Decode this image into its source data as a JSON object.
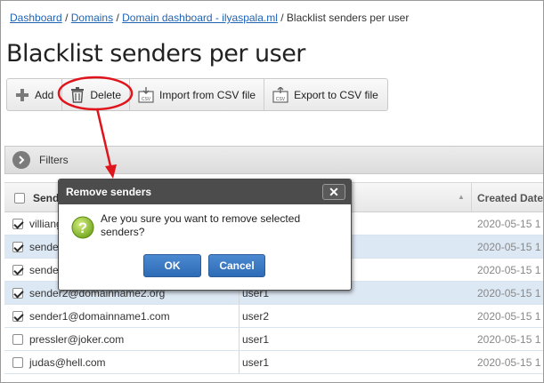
{
  "breadcrumb": {
    "items": [
      "Dashboard",
      "Domains",
      "Domain dashboard - ilyaspala.ml"
    ],
    "current": "Blacklist senders per user",
    "separator": "/"
  },
  "page_title": "Blacklist senders per user",
  "toolbar": {
    "add_label": "Add",
    "delete_label": "Delete",
    "import_label": "Import from CSV file",
    "export_label": "Export to CSV file",
    "csv_icon_text": "CSV"
  },
  "filters": {
    "label": "Filters"
  },
  "table": {
    "headers": {
      "sender": "Sender",
      "created": "Created Date"
    },
    "rows": [
      {
        "sender": "villiang",
        "user": "",
        "date": "2020-05-15 1",
        "checked": true,
        "selected": false
      },
      {
        "sender": "sender",
        "user": "",
        "date": "2020-05-15 1",
        "checked": true,
        "selected": true
      },
      {
        "sender": "sender",
        "user": "",
        "date": "2020-05-15 1",
        "checked": true,
        "selected": false
      },
      {
        "sender": "sender2@domainname2.org",
        "user": "user1",
        "date": "2020-05-15 1",
        "checked": true,
        "selected": true
      },
      {
        "sender": "sender1@domainname1.com",
        "user": "user2",
        "date": "2020-05-15 1",
        "checked": true,
        "selected": false
      },
      {
        "sender": "pressler@joker.com",
        "user": "user1",
        "date": "2020-05-15 1",
        "checked": false,
        "selected": false
      },
      {
        "sender": "judas@hell.com",
        "user": "user1",
        "date": "2020-05-15 1",
        "checked": false,
        "selected": false
      }
    ]
  },
  "dialog": {
    "title": "Remove senders",
    "close_symbol": "✕",
    "message": "Are you sure you want to remove selected senders?",
    "ok_label": "OK",
    "cancel_label": "Cancel"
  },
  "colors": {
    "link": "#1f63b6",
    "dialog_header": "#4c4c4c",
    "button": "#2e6bb6",
    "annotation": "#e0141b",
    "selected_row": "#dde8f5"
  }
}
